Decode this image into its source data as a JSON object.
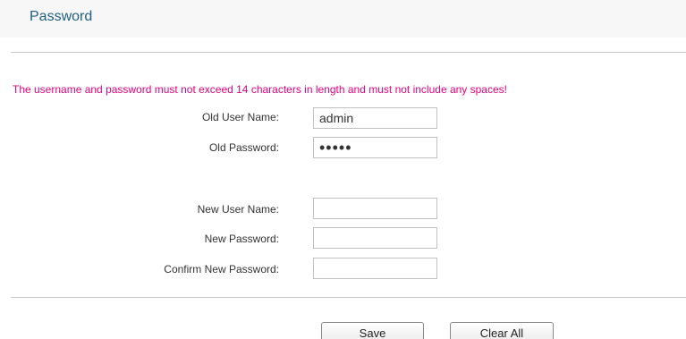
{
  "header": {
    "title": "Password"
  },
  "notice": {
    "text": "The username and password must not exceed 14 characters in length and must not include any spaces!",
    "color": "#e6007e"
  },
  "form": {
    "old_user_name": {
      "label": "Old User Name:",
      "value": "admin"
    },
    "old_password": {
      "label": "Old Password:",
      "value": "•••••"
    },
    "new_user_name": {
      "label": "New User Name:",
      "value": ""
    },
    "new_password": {
      "label": "New Password:",
      "value": ""
    },
    "confirm_new_password": {
      "label": "Confirm New Password:",
      "value": ""
    }
  },
  "buttons": {
    "save_label": "Save",
    "clear_all_label": "Clear All"
  },
  "colors": {
    "title": "#1f5f7f",
    "background": "#ffffff",
    "divider": "#c8c8c8"
  }
}
